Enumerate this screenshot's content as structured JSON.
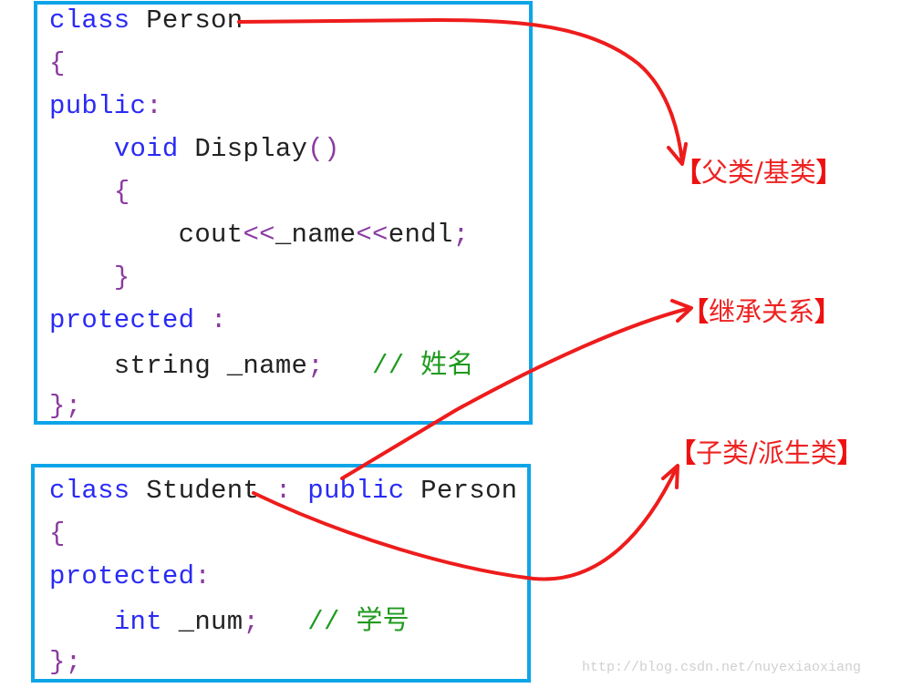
{
  "colors": {
    "box_border": "#0ea5e8",
    "keyword": "#2a2af5",
    "identifier": "#222222",
    "punctuation": "#8b3aa0",
    "comment": "#1f9a1f",
    "annotation": "#ee2222"
  },
  "base_class": {
    "lines": [
      [
        {
          "t": "kw",
          "v": "class"
        },
        {
          "t": "id",
          "v": " Person"
        }
      ],
      [
        {
          "t": "pn",
          "v": "{"
        }
      ],
      [
        {
          "t": "kw",
          "v": "public"
        },
        {
          "t": "pn",
          "v": ":"
        }
      ],
      [
        {
          "t": "id",
          "v": "    "
        },
        {
          "t": "kw",
          "v": "void"
        },
        {
          "t": "id",
          "v": " Display"
        },
        {
          "t": "pn",
          "v": "()"
        }
      ],
      [
        {
          "t": "id",
          "v": "    "
        },
        {
          "t": "pn",
          "v": "{"
        }
      ],
      [
        {
          "t": "id",
          "v": "        cout"
        },
        {
          "t": "pn",
          "v": "<<"
        },
        {
          "t": "id",
          "v": "_name"
        },
        {
          "t": "pn",
          "v": "<<"
        },
        {
          "t": "id",
          "v": "endl"
        },
        {
          "t": "pn",
          "v": ";"
        }
      ],
      [
        {
          "t": "id",
          "v": "    "
        },
        {
          "t": "pn",
          "v": "}"
        }
      ],
      [
        {
          "t": "kw",
          "v": "protected"
        },
        {
          "t": "pn",
          "v": " :"
        }
      ],
      [
        {
          "t": "id",
          "v": "    string _name"
        },
        {
          "t": "pn",
          "v": ";"
        },
        {
          "t": "cm",
          "v": "   // "
        },
        {
          "t": "cmcn",
          "v": "姓名"
        }
      ],
      [
        {
          "t": "pn",
          "v": "};"
        }
      ]
    ]
  },
  "derived_class": {
    "lines": [
      [
        {
          "t": "kw",
          "v": "class"
        },
        {
          "t": "id",
          "v": " Student "
        },
        {
          "t": "pn",
          "v": ":"
        },
        {
          "t": "kw",
          "v": " public"
        },
        {
          "t": "id",
          "v": " Person"
        }
      ],
      [
        {
          "t": "pn",
          "v": "{"
        }
      ],
      [
        {
          "t": "kw",
          "v": "protected"
        },
        {
          "t": "pn",
          "v": ":"
        }
      ],
      [
        {
          "t": "id",
          "v": "    "
        },
        {
          "t": "kw",
          "v": "int"
        },
        {
          "t": "id",
          "v": " _num"
        },
        {
          "t": "pn",
          "v": ";"
        },
        {
          "t": "cm",
          "v": "   // "
        },
        {
          "t": "cmcn",
          "v": "学号"
        }
      ],
      [
        {
          "t": "pn",
          "v": "};"
        }
      ]
    ]
  },
  "labels": {
    "base": {
      "open": "【",
      "text": "父类/基类",
      "close": "】"
    },
    "inheritance": {
      "open": "【",
      "text": "继承关系",
      "close": "】"
    },
    "derived": {
      "open": "【",
      "text": "子类/派生类",
      "close": "】"
    }
  },
  "watermark": "http://blog.csdn.net/nuyexiaoxiang"
}
